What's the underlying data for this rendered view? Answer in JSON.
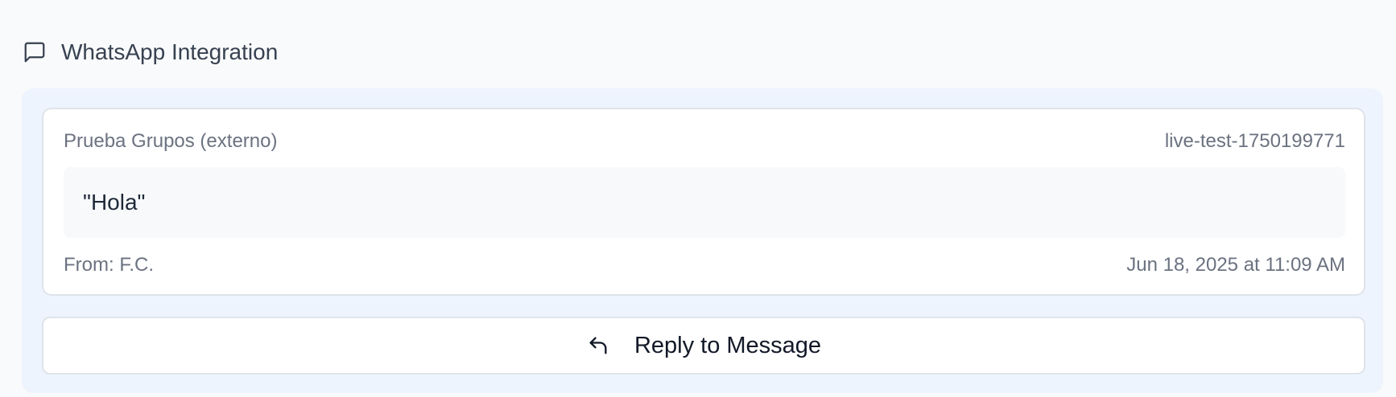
{
  "section": {
    "icon": "message-square-icon",
    "title": "WhatsApp Integration"
  },
  "message": {
    "group_name": "Prueba Grupos (externo)",
    "session_id": "live-test-1750199771",
    "text": "\"Hola\"",
    "from": "From: F.C.",
    "timestamp": "Jun 18, 2025 at 11:09 AM"
  },
  "reply_button": {
    "icon": "reply-arrow-icon",
    "label": "Reply to Message"
  },
  "colors": {
    "panel_background": "#eef4fd",
    "card_border": "#dfe3ea",
    "muted_text": "#6b7280",
    "heading_text": "#374151"
  }
}
